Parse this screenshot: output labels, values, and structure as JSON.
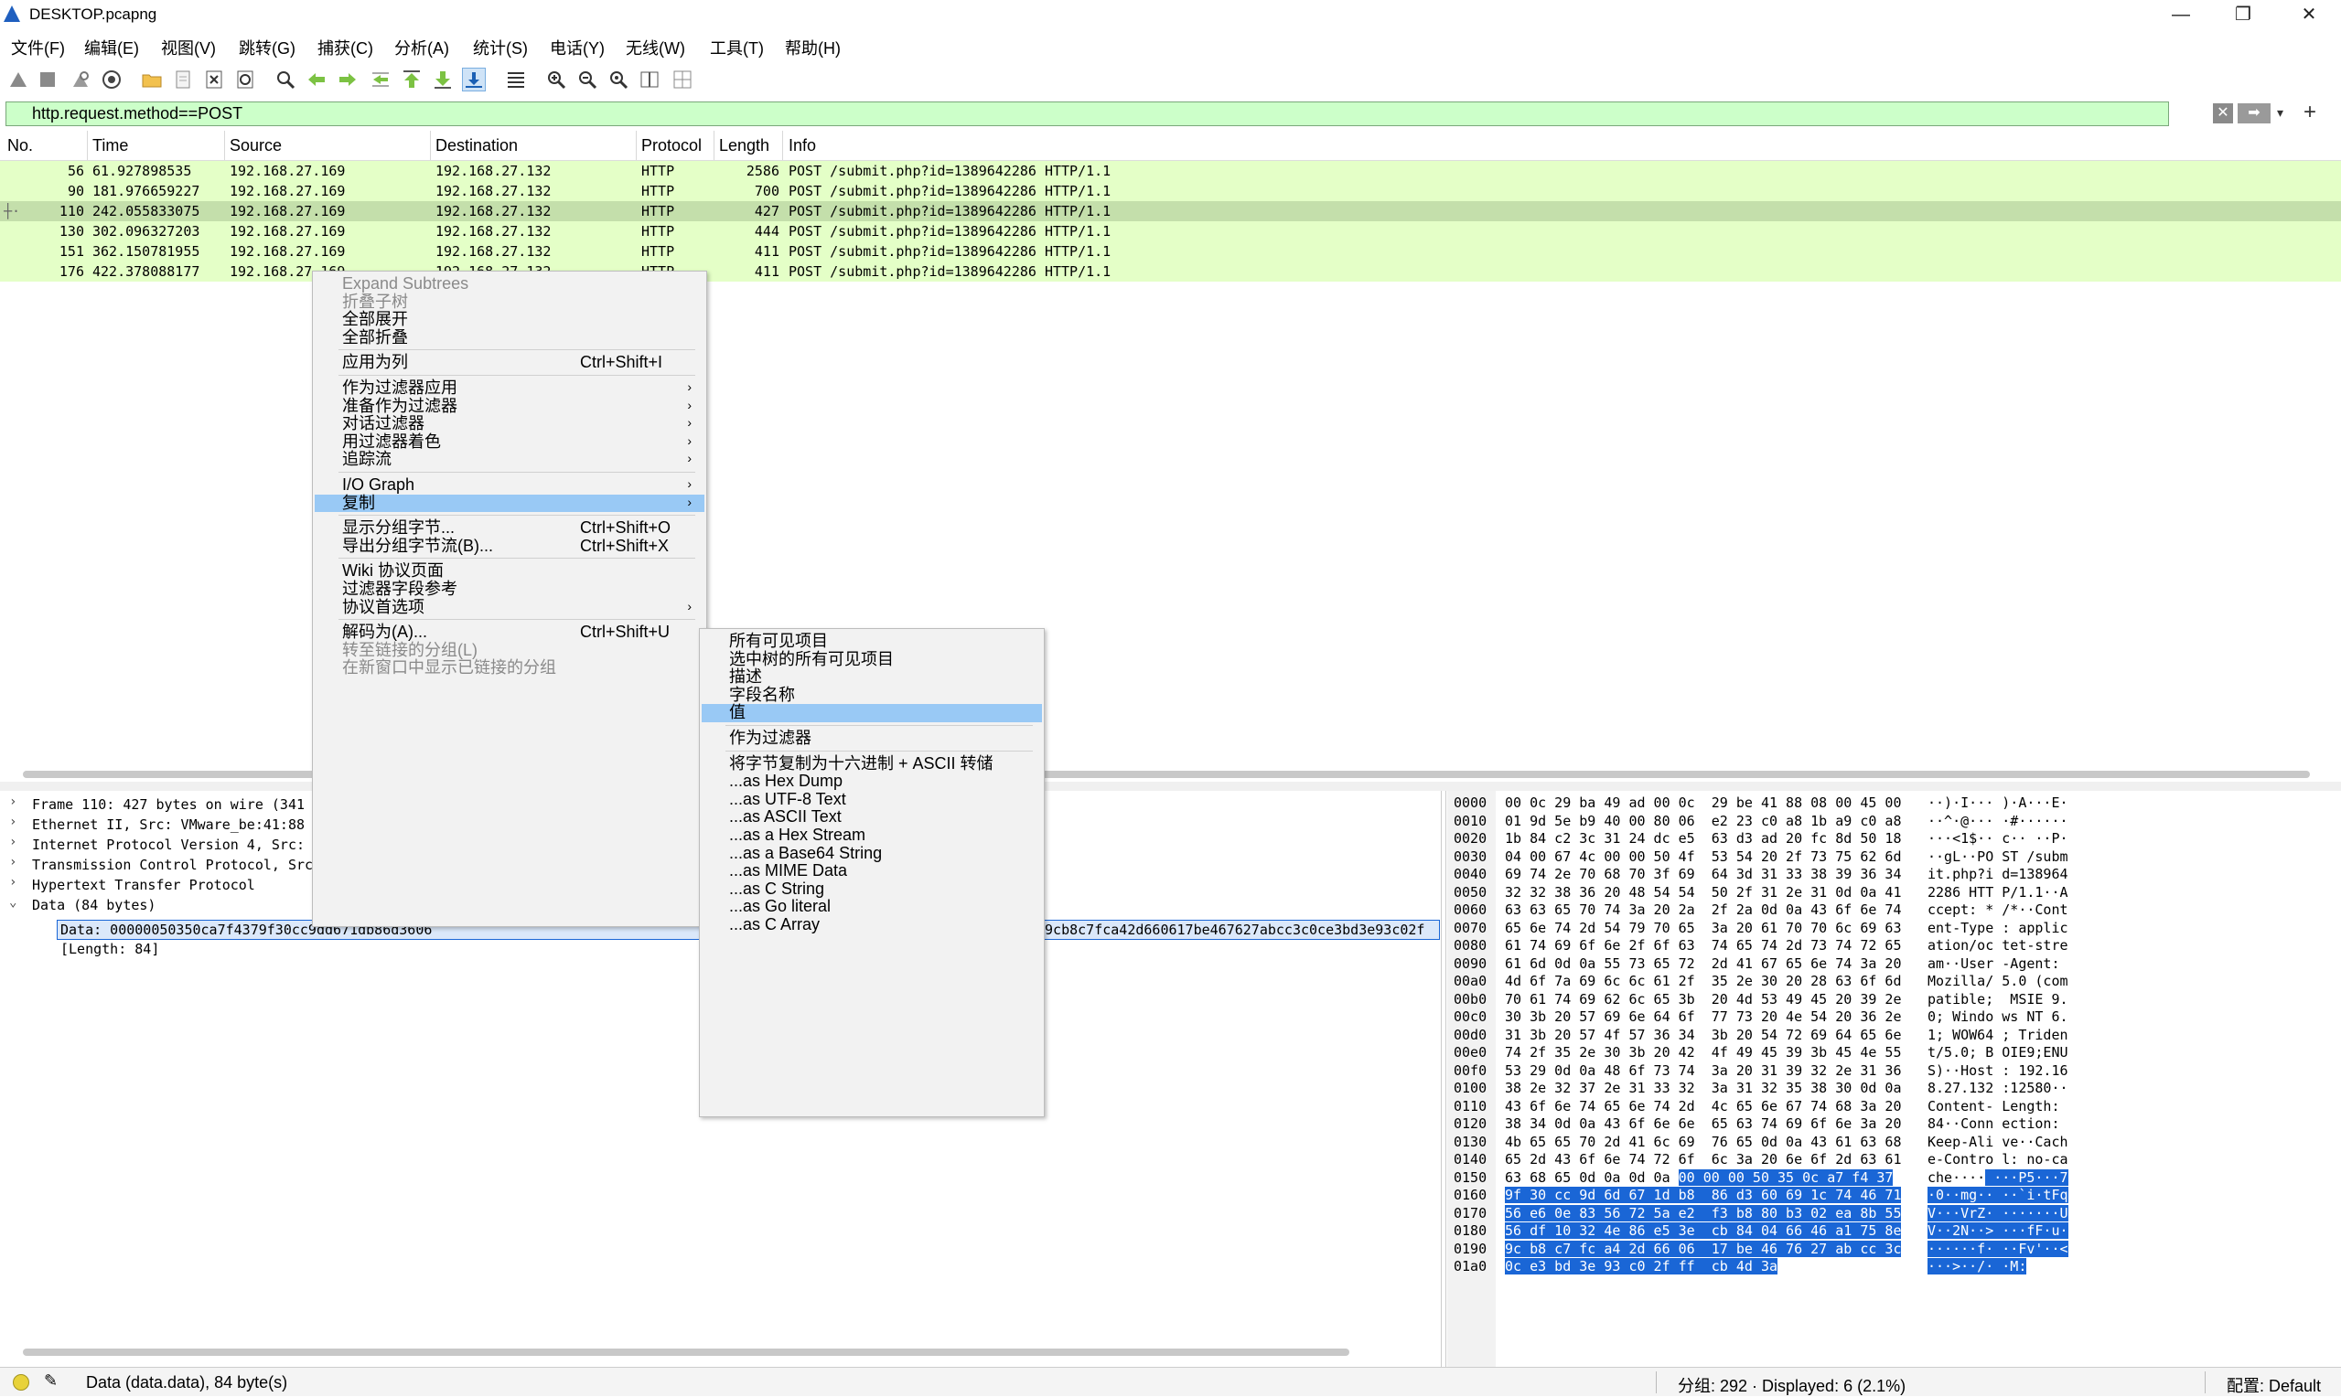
{
  "window": {
    "title": "DESKTOP.pcapng",
    "minimize": "—",
    "maximize": "❐",
    "close": "✕"
  },
  "menu": [
    "文件(F)",
    "编辑(E)",
    "视图(V)",
    "跳转(G)",
    "捕获(C)",
    "分析(A)",
    "统计(S)",
    "电话(Y)",
    "无线(W)",
    "工具(T)",
    "帮助(H)"
  ],
  "toolbar_icons": [
    "shark-start-icon",
    "stop-icon",
    "restart-icon",
    "options-icon",
    "open-icon",
    "save-icon",
    "close-file-icon",
    "reload-icon",
    "find-icon",
    "back-icon",
    "forward-icon",
    "goto-icon",
    "first-icon",
    "last-icon",
    "autoscroll-icon",
    "colorize-icon",
    "zoom-in-icon",
    "zoom-out-icon",
    "zoom-normal-icon",
    "resize-columns-icon",
    "layout-icon"
  ],
  "filter": {
    "value": "http.request.method==POST"
  },
  "columns": [
    "No.",
    "Time",
    "Source",
    "Destination",
    "Protocol",
    "Length",
    "Info"
  ],
  "packets": [
    {
      "no": "56",
      "time": "61.927898535",
      "src": "192.168.27.169",
      "dst": "192.168.27.132",
      "proto": "HTTP",
      "len": "2586",
      "info": "POST /submit.php?id=1389642286 HTTP/1.1"
    },
    {
      "no": "90",
      "time": "181.976659227",
      "src": "192.168.27.169",
      "dst": "192.168.27.132",
      "proto": "HTTP",
      "len": "700",
      "info": "POST /submit.php?id=1389642286 HTTP/1.1"
    },
    {
      "no": "110",
      "time": "242.055833075",
      "src": "192.168.27.169",
      "dst": "192.168.27.132",
      "proto": "HTTP",
      "len": "427",
      "info": "POST /submit.php?id=1389642286 HTTP/1.1"
    },
    {
      "no": "130",
      "time": "302.096327203",
      "src": "192.168.27.169",
      "dst": "192.168.27.132",
      "proto": "HTTP",
      "len": "444",
      "info": "POST /submit.php?id=1389642286 HTTP/1.1"
    },
    {
      "no": "151",
      "time": "362.150781955",
      "src": "192.168.27.169",
      "dst": "192.168.27.132",
      "proto": "HTTP",
      "len": "411",
      "info": "POST /submit.php?id=1389642286 HTTP/1.1"
    },
    {
      "no": "176",
      "time": "422.378088177",
      "src": "192.168.27.169",
      "dst": "192.168.27.132",
      "proto": "HTTP",
      "len": "411",
      "info": "POST /submit.php?id=1389642286 HTTP/1.1"
    }
  ],
  "details": {
    "rows": [
      "Frame 110: 427 bytes on wire (341",
      "Ethernet II, Src: VMware_be:41:88",
      "Internet Protocol Version 4, Src:",
      "Transmission Control Protocol, Src",
      "Hypertext Transfer Protocol",
      "Data (84 bytes)"
    ],
    "data_line_left": "Data: 00000050350ca7f4379f30cc9dd671db86d3606",
    "data_line_right": "e9cb8c7fca42d660617be467627abcc3c0ce3bd3e93c02f",
    "length_line": "[Length: 84]"
  },
  "hex": {
    "offsets": [
      "0000",
      "0010",
      "0020",
      "0030",
      "0040",
      "0050",
      "0060",
      "0070",
      "0080",
      "0090",
      "00a0",
      "00b0",
      "00c0",
      "00d0",
      "00e0",
      "00f0",
      "0100",
      "0110",
      "0120",
      "0130",
      "0140",
      "0150",
      "0160",
      "0170",
      "0180",
      "0190",
      "01a0"
    ],
    "bytes": [
      "00 0c 29 ba 49 ad 00 0c  29 be 41 88 08 00 45 00",
      "01 9d 5e b9 40 00 80 06  e2 23 c0 a8 1b a9 c0 a8",
      "1b 84 c2 3c 31 24 dc e5  63 d3 ad 20 fc 8d 50 18",
      "04 00 67 4c 00 00 50 4f  53 54 20 2f 73 75 62 6d",
      "69 74 2e 70 68 70 3f 69  64 3d 31 33 38 39 36 34",
      "32 32 38 36 20 48 54 54  50 2f 31 2e 31 0d 0a 41",
      "63 63 65 70 74 3a 20 2a  2f 2a 0d 0a 43 6f 6e 74",
      "65 6e 74 2d 54 79 70 65  3a 20 61 70 70 6c 69 63",
      "61 74 69 6f 6e 2f 6f 63  74 65 74 2d 73 74 72 65",
      "61 6d 0d 0a 55 73 65 72  2d 41 67 65 6e 74 3a 20",
      "4d 6f 7a 69 6c 6c 61 2f  35 2e 30 20 28 63 6f 6d",
      "70 61 74 69 62 6c 65 3b  20 4d 53 49 45 20 39 2e",
      "30 3b 20 57 69 6e 64 6f  77 73 20 4e 54 20 36 2e",
      "31 3b 20 57 4f 57 36 34  3b 20 54 72 69 64 65 6e",
      "74 2f 35 2e 30 3b 20 42  4f 49 45 39 3b 45 4e 55",
      "53 29 0d 0a 48 6f 73 74  3a 20 31 39 32 2e 31 36",
      "38 2e 32 37 2e 31 33 32  3a 31 32 35 38 30 0d 0a",
      "43 6f 6e 74 65 6e 74 2d  4c 65 6e 67 74 68 3a 20",
      "38 34 0d 0a 43 6f 6e 6e  65 63 74 69 6f 6e 3a 20",
      "4b 65 65 70 2d 41 6c 69  76 65 0d 0a 43 61 63 68",
      "65 2d 43 6f 6e 74 72 6f  6c 3a 20 6e 6f 2d 63 61",
      "63 68 65 0d 0a 0d 0a",
      "9f 30 cc 9d 6d 67 1d b8  86 d3 60 69 1c 74 46 71",
      "56 e6 0e 83 56 72 5a e2  f3 b8 80 b3 02 ea 8b 55",
      "56 df 10 32 4e 86 e5 3e  cb 84 04 66 46 a1 75 8e",
      "9c b8 c7 fc a4 2d 66 06  17 be 46 76 27 ab cc 3c",
      "0c e3 bd 3e 93 c0 2f ff  cb 4d 3a"
    ],
    "row0150_sel": "00 00 00 50 35 0c a7 f4 37",
    "ascii": [
      "··)·I··· )·A···E·",
      "··^·@··· ·#······",
      "···<1$·· c·· ··P·",
      "··gL··PO ST /subm",
      "it.php?i d=138964",
      "2286 HTT P/1.1··A",
      "ccept: * /*··Cont",
      "ent-Type : applic",
      "ation/oc tet-stre",
      "am··User -Agent: ",
      "Mozilla/ 5.0 (com",
      "patible;  MSIE 9.",
      "0; Windo ws NT 6.",
      "1; WOW64 ; Triden",
      "t/5.0; B OIE9;ENU",
      "S)··Host : 192.16",
      "8.27.132 :12580··",
      "Content- Length: ",
      "84··Conn ection: ",
      "Keep-Ali ve··Cach",
      "e-Contro l: no-ca",
      "che····",
      "·0··mg·· ··`i·tFq",
      "V···VrZ· ·······U",
      "V··2N··> ···fF·u·",
      "······f· ··Fv'··<",
      "···>··/· ·M:"
    ],
    "ascii0150_sel": " ···P5···7"
  },
  "context_menu": {
    "items": [
      {
        "label": "Expand Subtrees",
        "disabled": true
      },
      {
        "label": "折叠子树",
        "disabled": true
      },
      {
        "label": "全部展开"
      },
      {
        "label": "全部折叠"
      },
      {
        "sep": true
      },
      {
        "label": "应用为列",
        "shortcut": "Ctrl+Shift+I"
      },
      {
        "sep": true
      },
      {
        "label": "作为过滤器应用",
        "submenu": true
      },
      {
        "label": "准备作为过滤器",
        "submenu": true
      },
      {
        "label": "对话过滤器",
        "submenu": true
      },
      {
        "label": "用过滤器着色",
        "submenu": true
      },
      {
        "label": "追踪流",
        "submenu": true
      },
      {
        "sep": true
      },
      {
        "label": "I/O Graph",
        "submenu": true
      },
      {
        "label": "复制",
        "submenu": true,
        "highlight": true
      },
      {
        "sep": true
      },
      {
        "label": "显示分组字节...",
        "shortcut": "Ctrl+Shift+O"
      },
      {
        "label": "导出分组字节流(B)...",
        "shortcut": "Ctrl+Shift+X"
      },
      {
        "sep": true
      },
      {
        "label": "Wiki 协议页面"
      },
      {
        "label": "过滤器字段参考"
      },
      {
        "label": "协议首选项",
        "submenu": true
      },
      {
        "sep": true
      },
      {
        "label": "解码为(A)...",
        "shortcut": "Ctrl+Shift+U"
      },
      {
        "label": "转至链接的分组(L)",
        "disabled": true
      },
      {
        "label": "在新窗口中显示已链接的分组",
        "disabled": true
      }
    ]
  },
  "copy_submenu": {
    "items": [
      {
        "label": "所有可见项目"
      },
      {
        "label": "选中树的所有可见项目"
      },
      {
        "label": "描述"
      },
      {
        "label": "字段名称"
      },
      {
        "label": "值",
        "highlight": true
      },
      {
        "sep": true
      },
      {
        "label": "作为过滤器"
      },
      {
        "sep": true
      },
      {
        "label": "将字节复制为十六进制 + ASCII 转储"
      },
      {
        "label": "...as Hex Dump"
      },
      {
        "label": "...as UTF-8 Text"
      },
      {
        "label": "...as ASCII Text"
      },
      {
        "label": "...as a Hex Stream"
      },
      {
        "label": "...as a Base64 String"
      },
      {
        "label": "...as MIME Data"
      },
      {
        "label": "...as C String"
      },
      {
        "label": "...as Go literal"
      },
      {
        "label": "...as C Array"
      }
    ]
  },
  "status": {
    "field": "Data (data.data), 84 byte(s)",
    "packets": "分组: 292 · Displayed: 6 (2.1%)",
    "profile": "配置: Default"
  }
}
